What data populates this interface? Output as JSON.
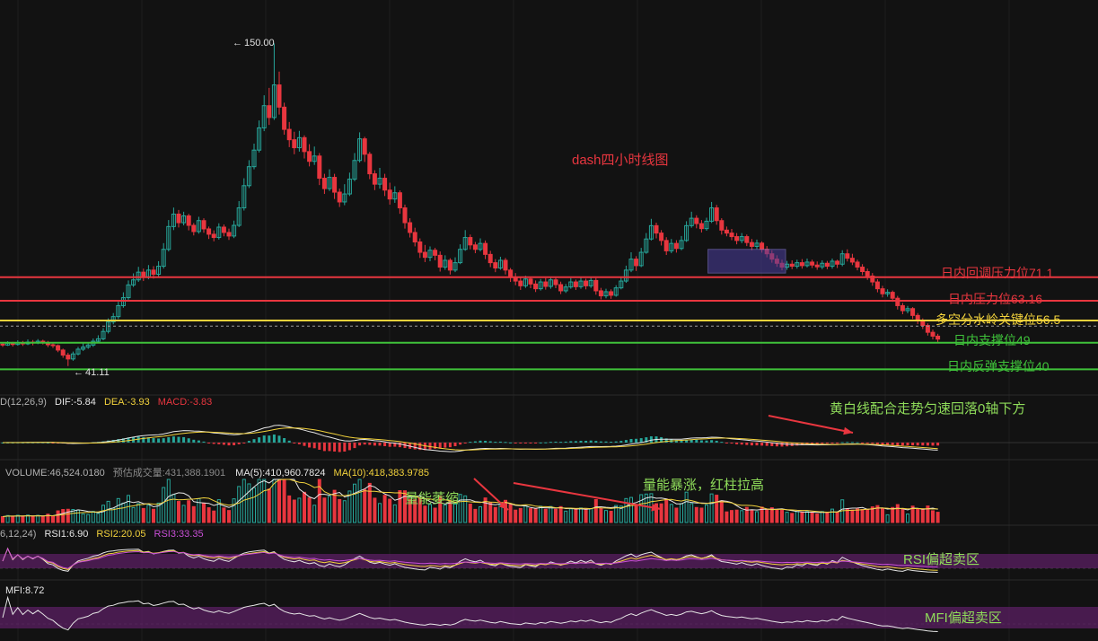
{
  "chart_data": {
    "type": "candlestick",
    "title": "dash四小时线图",
    "price_range": [
      38,
      154
    ],
    "price_extremes": {
      "high": "150.00",
      "low": "41.11"
    },
    "levels": [
      {
        "label": "日内回调压力位71.1",
        "value": 71.1,
        "color": "#e8363f"
      },
      {
        "label": "日内压力位63.16",
        "value": 63.16,
        "color": "#e8363f"
      },
      {
        "label": "多空分水岭关键位56.5",
        "value": 56.5,
        "color": "#f2d23c"
      },
      {
        "label": "日内支撑位49",
        "value": 49,
        "color": "#3fc23a"
      },
      {
        "label": "日内反弹支撑位40",
        "value": 40,
        "color": "#3fc23a"
      }
    ],
    "candles": [
      [
        48.5,
        48.2,
        49.2,
        47.6
      ],
      [
        48.2,
        48.8,
        49.5,
        47.9
      ],
      [
        48.8,
        48.4,
        49.3,
        47.7
      ],
      [
        48.4,
        49.0,
        49.8,
        48.0
      ],
      [
        49.0,
        48.6,
        49.6,
        47.9
      ],
      [
        48.6,
        49.2,
        50.1,
        48.2
      ],
      [
        49.2,
        48.9,
        49.9,
        48.1
      ],
      [
        48.9,
        49.5,
        50.2,
        48.5
      ],
      [
        49.5,
        49.1,
        50.0,
        48.4
      ],
      [
        49.1,
        48.3,
        49.6,
        47.5
      ],
      [
        48.3,
        48.0,
        48.9,
        47.2
      ],
      [
        48.0,
        46.5,
        48.4,
        45.8
      ],
      [
        46.5,
        44.8,
        47.0,
        43.9
      ],
      [
        44.8,
        43.5,
        45.6,
        41.11
      ],
      [
        43.5,
        45.2,
        46.0,
        42.9
      ],
      [
        45.2,
        46.8,
        47.6,
        44.7
      ],
      [
        46.8,
        47.5,
        48.8,
        46.2
      ],
      [
        47.5,
        48.2,
        49.0,
        46.9
      ],
      [
        48.2,
        49.5,
        50.4,
        47.6
      ],
      [
        49.5,
        50.3,
        51.5,
        48.8
      ],
      [
        50.3,
        52.8,
        53.9,
        49.8
      ],
      [
        52.8,
        56.0,
        57.2,
        52.1
      ],
      [
        56.0,
        57.8,
        59.0,
        55.2
      ],
      [
        57.8,
        61.5,
        62.8,
        57.0
      ],
      [
        61.5,
        64.2,
        66.0,
        60.8
      ],
      [
        64.2,
        68.5,
        70.0,
        63.5
      ],
      [
        68.5,
        70.2,
        72.4,
        67.8
      ],
      [
        70.2,
        72.8,
        74.6,
        69.5
      ],
      [
        72.8,
        71.2,
        74.0,
        69.8
      ],
      [
        71.2,
        73.5,
        75.2,
        70.4
      ],
      [
        73.5,
        72.1,
        74.8,
        70.6
      ],
      [
        72.1,
        74.8,
        76.5,
        71.3
      ],
      [
        74.8,
        80.5,
        82.6,
        74.0
      ],
      [
        80.5,
        88.2,
        90.4,
        79.8
      ],
      [
        88.2,
        92.4,
        94.6,
        87.0
      ],
      [
        92.4,
        89.5,
        93.8,
        87.9
      ],
      [
        89.5,
        91.8,
        93.2,
        88.6
      ],
      [
        91.8,
        88.6,
        92.5,
        86.9
      ],
      [
        88.6,
        86.5,
        89.4,
        85.2
      ],
      [
        86.5,
        90.2,
        91.5,
        85.8
      ],
      [
        90.2,
        87.4,
        91.0,
        86.1
      ],
      [
        87.4,
        85.6,
        88.2,
        84.0
      ],
      [
        85.6,
        84.5,
        86.9,
        83.2
      ],
      [
        84.5,
        88.0,
        89.3,
        83.8
      ],
      [
        88.0,
        86.2,
        88.9,
        84.9
      ],
      [
        86.2,
        85.0,
        87.5,
        83.7
      ],
      [
        85.0,
        88.6,
        90.2,
        84.3
      ],
      [
        88.6,
        94.5,
        96.8,
        88.0
      ],
      [
        94.5,
        102.0,
        104.5,
        93.6
      ],
      [
        102.0,
        108.4,
        110.6,
        101.2
      ],
      [
        108.4,
        114.0,
        116.2,
        107.5
      ],
      [
        114.0,
        121.5,
        124.0,
        113.2
      ],
      [
        121.5,
        129.0,
        132.5,
        120.4
      ],
      [
        129.0,
        125.0,
        135.0,
        122.5
      ],
      [
        125.0,
        136.0,
        150.0,
        124.2
      ],
      [
        136.0,
        128.5,
        140.5,
        126.0
      ],
      [
        128.5,
        121.0,
        130.0,
        119.2
      ],
      [
        121.0,
        117.5,
        123.5,
        115.0
      ],
      [
        117.5,
        114.8,
        120.2,
        112.6
      ],
      [
        114.8,
        118.2,
        120.5,
        113.5
      ],
      [
        118.2,
        113.5,
        119.0,
        111.2
      ],
      [
        113.5,
        110.2,
        116.0,
        108.5
      ],
      [
        110.2,
        112.0,
        115.2,
        109.0
      ],
      [
        112.0,
        104.5,
        113.0,
        102.2
      ],
      [
        104.5,
        101.0,
        106.0,
        99.2
      ],
      [
        101.0,
        104.8,
        107.5,
        100.2
      ],
      [
        104.8,
        99.8,
        106.0,
        97.5
      ],
      [
        99.8,
        96.5,
        101.0,
        94.8
      ],
      [
        96.5,
        99.2,
        102.5,
        95.4
      ],
      [
        99.2,
        104.2,
        106.4,
        98.5
      ],
      [
        104.2,
        110.5,
        113.0,
        103.5
      ],
      [
        110.5,
        117.8,
        120.0,
        109.8
      ],
      [
        117.8,
        112.6,
        118.5,
        110.0
      ],
      [
        112.6,
        106.0,
        113.4,
        104.2
      ],
      [
        106.0,
        102.5,
        107.2,
        100.5
      ],
      [
        102.5,
        104.5,
        108.0,
        101.0
      ],
      [
        104.5,
        100.5,
        106.0,
        98.5
      ],
      [
        100.5,
        97.5,
        103.0,
        95.6
      ],
      [
        97.5,
        99.6,
        101.8,
        96.2
      ],
      [
        99.6,
        94.5,
        100.4,
        92.5
      ],
      [
        94.5,
        89.5,
        95.6,
        87.5
      ],
      [
        89.5,
        86.2,
        91.0,
        84.5
      ],
      [
        86.2,
        83.0,
        87.8,
        81.5
      ],
      [
        83.0,
        79.5,
        84.2,
        77.6
      ],
      [
        79.5,
        77.8,
        82.0,
        76.2
      ],
      [
        77.8,
        80.2,
        81.5,
        76.5
      ],
      [
        80.2,
        78.5,
        81.0,
        76.8
      ],
      [
        78.5,
        74.5,
        79.8,
        73.0
      ],
      [
        74.5,
        76.8,
        78.5,
        73.6
      ],
      [
        76.8,
        73.5,
        77.5,
        72.0
      ],
      [
        73.5,
        76.0,
        77.8,
        72.8
      ],
      [
        76.0,
        80.5,
        82.2,
        75.5
      ],
      [
        80.5,
        84.5,
        87.0,
        80.0
      ],
      [
        84.5,
        82.0,
        85.5,
        80.5
      ],
      [
        82.0,
        80.5,
        83.0,
        79.2
      ],
      [
        80.5,
        82.5,
        84.2,
        79.8
      ],
      [
        82.5,
        78.8,
        83.5,
        77.2
      ],
      [
        78.8,
        76.0,
        80.0,
        74.5
      ],
      [
        76.0,
        74.2,
        77.2,
        72.8
      ],
      [
        74.2,
        76.8,
        78.0,
        73.6
      ],
      [
        76.8,
        73.5,
        77.6,
        72.0
      ],
      [
        73.5,
        71.0,
        74.2,
        69.5
      ],
      [
        71.0,
        69.8,
        72.5,
        68.4
      ],
      [
        69.8,
        68.2,
        71.0,
        66.8
      ],
      [
        68.2,
        70.5,
        71.6,
        67.5
      ],
      [
        70.5,
        68.8,
        71.2,
        67.4
      ],
      [
        68.8,
        67.2,
        70.0,
        66.1
      ],
      [
        67.2,
        69.5,
        70.5,
        66.6
      ],
      [
        69.5,
        68.0,
        70.8,
        66.9
      ],
      [
        68.0,
        70.2,
        71.2,
        67.2
      ],
      [
        70.2,
        68.6,
        71.0,
        67.4
      ],
      [
        68.6,
        66.5,
        69.6,
        65.4
      ],
      [
        66.5,
        67.8,
        68.8,
        65.8
      ],
      [
        67.8,
        69.5,
        70.8,
        67.2
      ],
      [
        69.5,
        67.9,
        70.3,
        66.8
      ],
      [
        67.9,
        69.8,
        70.9,
        67.2
      ],
      [
        69.8,
        68.2,
        70.6,
        67.0
      ],
      [
        68.2,
        70.0,
        71.0,
        67.5
      ],
      [
        70.0,
        66.5,
        70.8,
        65.2
      ],
      [
        66.5,
        64.8,
        67.5,
        63.6
      ],
      [
        64.8,
        66.2,
        67.2,
        64.0
      ],
      [
        66.2,
        65.0,
        67.0,
        63.8
      ],
      [
        65.0,
        67.5,
        68.4,
        64.5
      ],
      [
        67.5,
        69.8,
        71.0,
        67.0
      ],
      [
        69.8,
        73.5,
        75.0,
        69.2
      ],
      [
        73.5,
        77.2,
        79.5,
        72.8
      ],
      [
        77.2,
        75.0,
        78.2,
        73.2
      ],
      [
        75.0,
        79.5,
        81.0,
        74.5
      ],
      [
        79.5,
        84.0,
        86.0,
        79.0
      ],
      [
        84.0,
        88.5,
        90.8,
        83.5
      ],
      [
        88.5,
        86.0,
        89.5,
        84.2
      ],
      [
        86.0,
        83.5,
        87.0,
        81.8
      ],
      [
        83.5,
        80.0,
        84.6,
        78.6
      ],
      [
        80.0,
        82.5,
        84.0,
        79.2
      ],
      [
        82.5,
        80.8,
        83.6,
        79.4
      ],
      [
        80.8,
        83.5,
        85.0,
        80.2
      ],
      [
        83.5,
        88.5,
        90.0,
        83.0
      ],
      [
        88.5,
        91.0,
        93.2,
        87.8
      ],
      [
        91.0,
        89.2,
        92.0,
        87.6
      ],
      [
        89.2,
        87.5,
        90.4,
        86.2
      ],
      [
        87.5,
        90.0,
        91.2,
        86.8
      ],
      [
        90.0,
        94.5,
        96.5,
        89.4
      ],
      [
        94.5,
        90.2,
        95.5,
        88.8
      ],
      [
        90.2,
        87.0,
        91.0,
        85.5
      ],
      [
        87.0,
        86.0,
        88.2,
        84.9
      ],
      [
        86.0,
        84.8,
        87.4,
        83.6
      ],
      [
        84.8,
        83.5,
        86.0,
        82.2
      ],
      [
        83.5,
        84.8,
        86.0,
        82.6
      ],
      [
        84.8,
        82.8,
        85.5,
        81.6
      ],
      [
        82.8,
        81.5,
        84.0,
        80.2
      ],
      [
        81.5,
        82.6,
        83.8,
        80.6
      ],
      [
        82.6,
        80.5,
        83.2,
        79.4
      ],
      [
        80.5,
        79.0,
        81.6,
        77.8
      ],
      [
        79.0,
        77.2,
        80.2,
        76.0
      ],
      [
        77.2,
        75.8,
        78.5,
        74.6
      ],
      [
        75.8,
        74.5,
        77.0,
        73.4
      ],
      [
        74.5,
        75.5,
        76.6,
        73.6
      ],
      [
        75.5,
        74.8,
        76.8,
        73.8
      ],
      [
        74.8,
        76.0,
        77.0,
        74.0
      ],
      [
        76.0,
        75.0,
        77.2,
        74.0
      ],
      [
        75.0,
        76.2,
        77.4,
        74.4
      ],
      [
        76.2,
        75.2,
        77.0,
        74.2
      ],
      [
        75.2,
        74.6,
        76.4,
        73.6
      ],
      [
        74.6,
        75.8,
        76.8,
        73.8
      ],
      [
        75.8,
        74.8,
        76.6,
        73.8
      ],
      [
        74.8,
        76.5,
        77.4,
        74.0
      ],
      [
        76.5,
        75.5,
        77.0,
        74.2
      ],
      [
        75.5,
        79.0,
        80.2,
        74.8
      ],
      [
        79.0,
        77.5,
        80.5,
        76.4
      ],
      [
        77.5,
        76.2,
        79.0,
        75.2
      ],
      [
        76.2,
        74.5,
        77.0,
        73.4
      ],
      [
        74.5,
        73.0,
        75.5,
        71.8
      ],
      [
        73.0,
        71.5,
        74.0,
        70.2
      ],
      [
        71.5,
        69.5,
        72.5,
        68.2
      ],
      [
        69.5,
        67.2,
        70.4,
        66.0
      ],
      [
        67.2,
        65.5,
        68.2,
        64.3
      ],
      [
        65.5,
        66.0,
        67.0,
        64.5
      ],
      [
        66.0,
        64.0,
        66.6,
        62.8
      ],
      [
        64.0,
        61.5,
        64.8,
        60.2
      ],
      [
        61.5,
        59.8,
        62.4,
        58.6
      ],
      [
        59.8,
        60.5,
        61.4,
        58.9
      ],
      [
        60.5,
        58.2,
        61.0,
        57.0
      ],
      [
        58.2,
        56.5,
        59.0,
        55.3
      ],
      [
        56.5,
        54.8,
        57.2,
        53.6
      ],
      [
        54.8,
        52.5,
        55.5,
        51.4
      ],
      [
        52.5,
        51.2,
        53.4,
        50.1
      ],
      [
        51.2,
        50.2,
        52.0,
        49.0
      ]
    ],
    "macd": {
      "label": "D(12,26,9)",
      "dif": {
        "label": "DIF:-5.84",
        "color": "#e6e6e6"
      },
      "dea": {
        "label": "DEA:-3.93",
        "color": "#f2d23c"
      },
      "macd": {
        "label": "MACD:-3.83",
        "color": "#e8363f"
      }
    },
    "volume": {
      "label": "VOLUME:46,524.0180",
      "estimate": "预估成交量:431,388.1901",
      "ma5": {
        "label": "MA(5):410,960.7824",
        "color": "#e6e6e6"
      },
      "ma10": {
        "label": "MA(10):418,383.9785",
        "color": "#f2d23c"
      }
    },
    "rsi": {
      "params": "6,12,24)",
      "rsi1": {
        "label": "RSI1:6.90",
        "color": "#e6e6e6"
      },
      "rsi2": {
        "label": "RSI2:20.05",
        "color": "#f2d23c"
      },
      "rsi3": {
        "label": "RSI3:33.35",
        "color": "#c84fd6"
      }
    },
    "mfi": {
      "label": "MFI:8.72",
      "color": "#e6e6e6"
    },
    "annotations": {
      "macd_note": "黄白线配合走势匀速回落0轴下方",
      "volume_note_shrink": "量能萎缩",
      "volume_note_surge": "量能暴涨，红柱拉高",
      "rsi_zone": "RSI偏超卖区",
      "mfi_zone": "MFI偏超卖区"
    },
    "colors": {
      "up": "#26a69a",
      "down": "#e8363f",
      "zone": "#5b1f63",
      "background": "#121212",
      "note_green": "#8fdc5a",
      "title_red": "#e8363f"
    }
  }
}
